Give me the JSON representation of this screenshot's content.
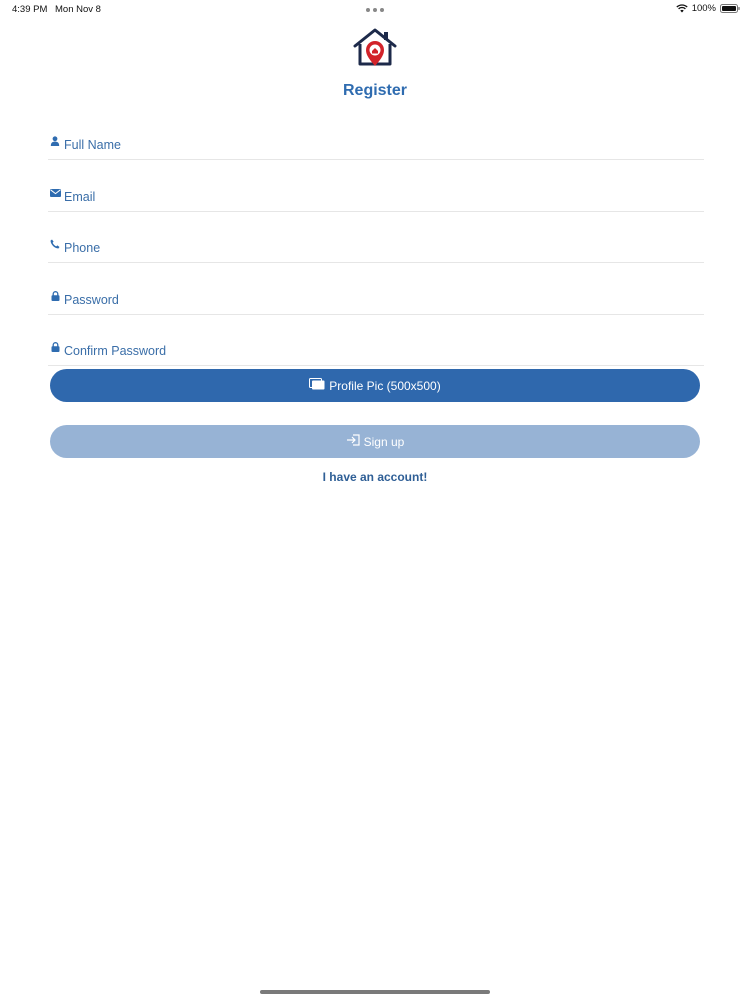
{
  "status_bar": {
    "time": "4:39 PM",
    "date": "Mon Nov 8",
    "battery": "100%",
    "icons": [
      "wifi-icon",
      "battery-icon"
    ]
  },
  "header": {
    "logo": "house-location-logo",
    "title": "Register"
  },
  "form": {
    "full_name": {
      "placeholder": "Full Name",
      "value": "",
      "icon": "person-icon"
    },
    "email": {
      "placeholder": "Email",
      "value": "",
      "icon": "envelope-icon"
    },
    "phone": {
      "placeholder": "Phone",
      "value": "",
      "icon": "phone-icon"
    },
    "password": {
      "placeholder": "Password",
      "value": "",
      "icon": "lock-icon"
    },
    "confirm_password": {
      "placeholder": "Confirm Password",
      "value": "",
      "icon": "lock-icon"
    }
  },
  "buttons": {
    "profile_pic": "Profile Pic (500x500)",
    "sign_up": "Sign up",
    "have_account": "I have an account!"
  },
  "colors": {
    "primary": "#2f68ad",
    "primary_disabled": "#97b3d5",
    "text_blue": "#2f6cb0",
    "logo_navy": "#1d2a4a",
    "logo_red": "#d2232a"
  }
}
